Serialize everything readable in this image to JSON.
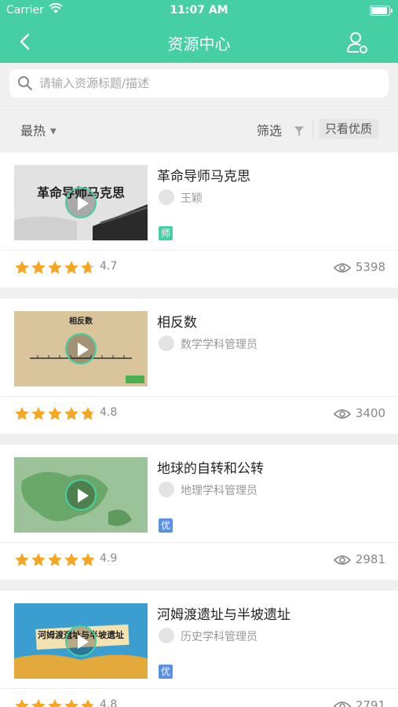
{
  "status_bar": {
    "carrier": "Carrier",
    "time": "11:07 AM"
  },
  "nav": {
    "title": "资源中心"
  },
  "search": {
    "placeholder": "请输入资源标题/描述"
  },
  "filter_bar": {
    "sort_label": "最热",
    "filter_label": "筛选",
    "quality_label": "只看优质"
  },
  "colors": {
    "accent": "#46cfa3",
    "star": "#f5a623",
    "badge_teacher": "#46cfa3",
    "badge_quality": "#5b8fe6"
  },
  "cards": [
    {
      "title": "革命导师马克思",
      "author": "王颖",
      "badge": "师",
      "badge_type": "teacher",
      "rating": "4.7",
      "rating_value": 4.7,
      "views": "5398",
      "thumb_text": "革命导师马克思"
    },
    {
      "title": "相反数",
      "author": "数学学科管理员",
      "badge": "",
      "badge_type": "",
      "rating": "4.8",
      "rating_value": 4.8,
      "views": "3400",
      "thumb_text": "相反数"
    },
    {
      "title": "地球的自转和公转",
      "author": "地理学科管理员",
      "badge": "优",
      "badge_type": "quality",
      "rating": "4.9",
      "rating_value": 4.9,
      "views": "2981",
      "thumb_text": ""
    },
    {
      "title": "河姆渡遗址与半坡遗址",
      "author": "历史学科管理员",
      "badge": "优",
      "badge_type": "quality",
      "rating": "4.8",
      "rating_value": 4.8,
      "views": "2791",
      "thumb_text": "河姆渡遗址与半坡遗址"
    }
  ]
}
